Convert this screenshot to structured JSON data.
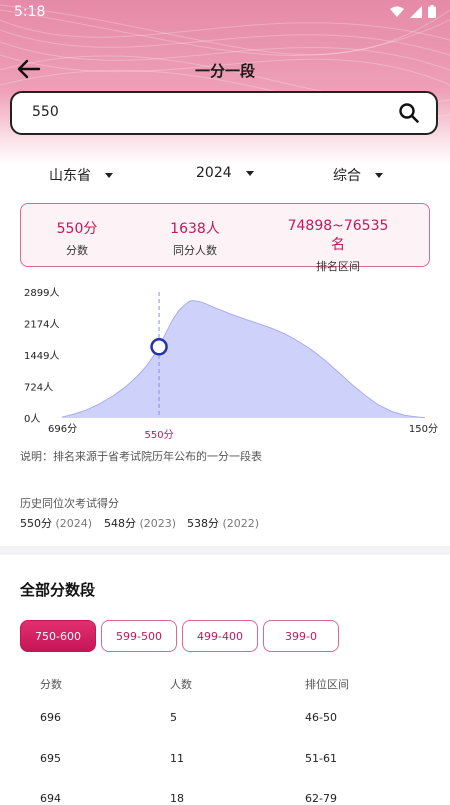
{
  "status": {
    "time": "5:18"
  },
  "header": {
    "title": "一分一段"
  },
  "search": {
    "value": "550"
  },
  "filters": {
    "province": "山东省",
    "year": "2024",
    "category": "综合"
  },
  "stats": [
    {
      "value": "550分",
      "label": "分数"
    },
    {
      "value": "1638人",
      "label": "同分人数"
    },
    {
      "value": "74898~76535名",
      "label": "排名区间"
    }
  ],
  "chart_data": {
    "type": "area",
    "y_ticks": [
      "2899人",
      "2174人",
      "1449人",
      "724人",
      "0人"
    ],
    "y_tick_values": [
      2899,
      2174,
      1449,
      724,
      0
    ],
    "x_start_label": "696分",
    "x_end_label": "150分",
    "x_range": [
      696,
      150
    ],
    "marker_label": "550分",
    "marker_x": 550,
    "marker_y": 1638,
    "ylim": [
      0,
      2899
    ],
    "x": [
      696,
      680,
      660,
      640,
      620,
      600,
      580,
      570,
      560,
      550,
      540,
      530,
      520,
      510,
      505,
      500,
      490,
      480,
      470,
      460,
      440,
      420,
      400,
      380,
      360,
      340,
      320,
      300,
      280,
      260,
      240,
      220,
      200,
      180,
      160,
      150
    ],
    "y": [
      20,
      80,
      180,
      320,
      500,
      720,
      1000,
      1180,
      1390,
      1638,
      1950,
      2250,
      2480,
      2620,
      2680,
      2700,
      2680,
      2630,
      2560,
      2500,
      2380,
      2270,
      2170,
      2060,
      1930,
      1760,
      1560,
      1320,
      1050,
      770,
      520,
      300,
      150,
      60,
      20,
      10
    ],
    "grid": false,
    "color": "#c9ccf8"
  },
  "note": "说明：排名来源于省考试院历年公布的一分一段表",
  "history": {
    "title": "历史同位次考试得分",
    "items": [
      {
        "score": "550分",
        "year": "(2024)"
      },
      {
        "score": "548分",
        "year": "(2023)"
      },
      {
        "score": "538分",
        "year": "(2022)"
      }
    ]
  },
  "section_title": "全部分数段",
  "ranges": [
    "750-600",
    "599-500",
    "499-400",
    "399-0"
  ],
  "table": {
    "headers": [
      "分数",
      "人数",
      "排位区间"
    ],
    "rows": [
      [
        "696",
        "5",
        "46-50"
      ],
      [
        "695",
        "11",
        "51-61"
      ],
      [
        "694",
        "18",
        "62-79"
      ]
    ]
  },
  "colors": {
    "accent": "#c2185b",
    "header": "#e58aa8",
    "chart_fill": "#c9ccf8",
    "chart_line": "#a9adf0",
    "marker": "#2233aa"
  }
}
